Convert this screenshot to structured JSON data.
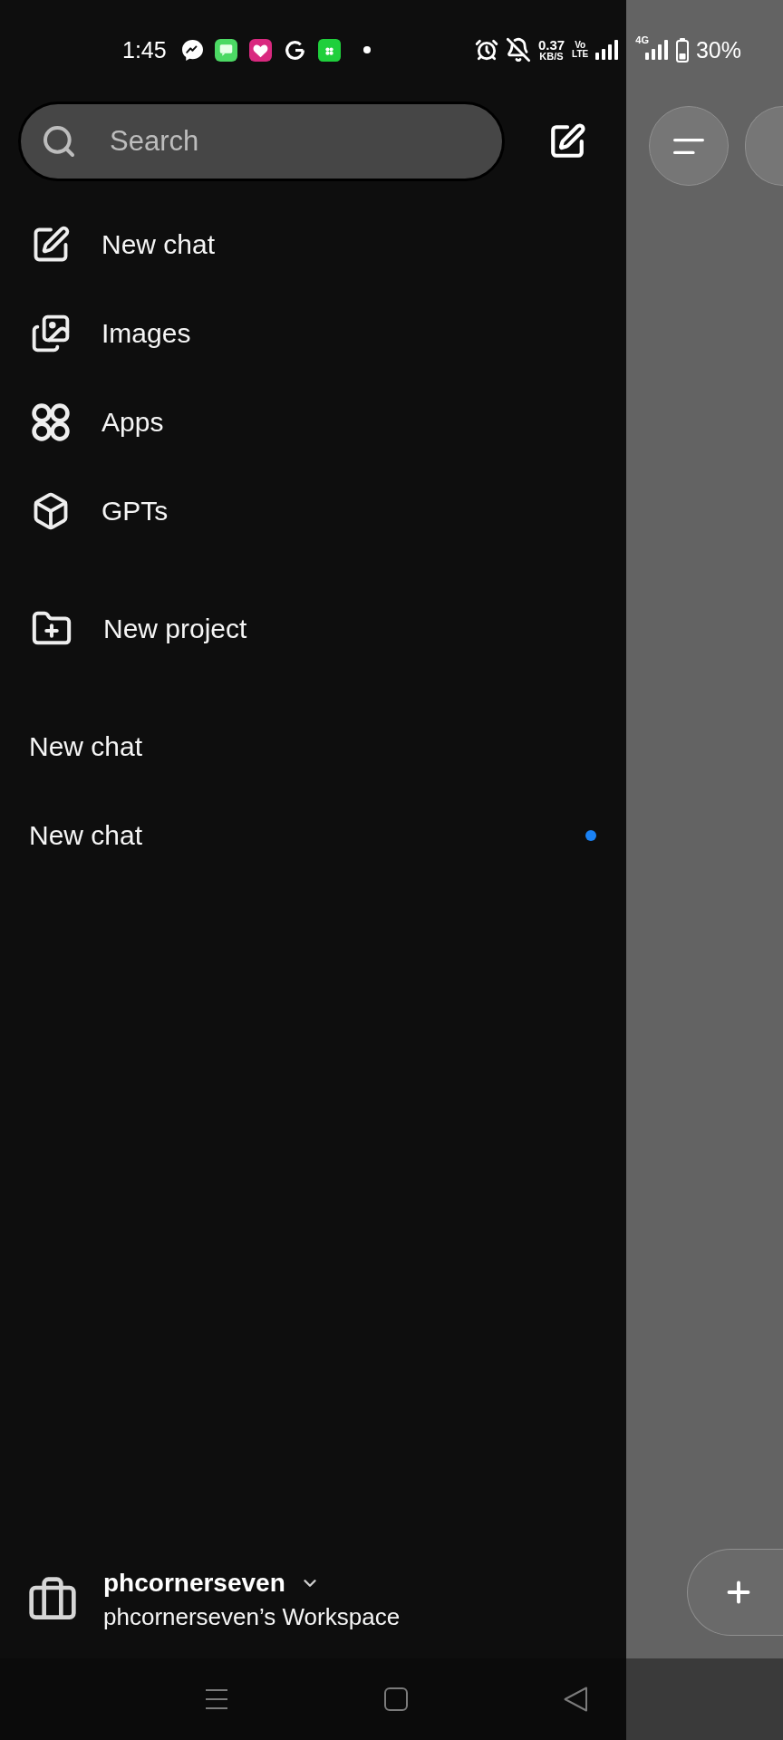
{
  "status_bar": {
    "time": "1:45",
    "net_speed": "0.37",
    "net_unit": "KB/S",
    "volte": [
      "Vo",
      "LTE"
    ],
    "network": "4G",
    "battery": "30%"
  },
  "search": {
    "placeholder": "Search"
  },
  "menu": [
    {
      "kind": "compose",
      "label": "New chat"
    },
    {
      "kind": "images",
      "label": "Images"
    },
    {
      "kind": "apps",
      "label": "Apps"
    },
    {
      "kind": "gpts",
      "label": "GPTs"
    }
  ],
  "project_action": {
    "label": "New project"
  },
  "history": [
    {
      "title": "New chat",
      "unread": false
    },
    {
      "title": "New chat",
      "unread": true
    }
  ],
  "account": {
    "name": "phcornerseven",
    "workspace": "phcornerseven’s Workspace"
  }
}
